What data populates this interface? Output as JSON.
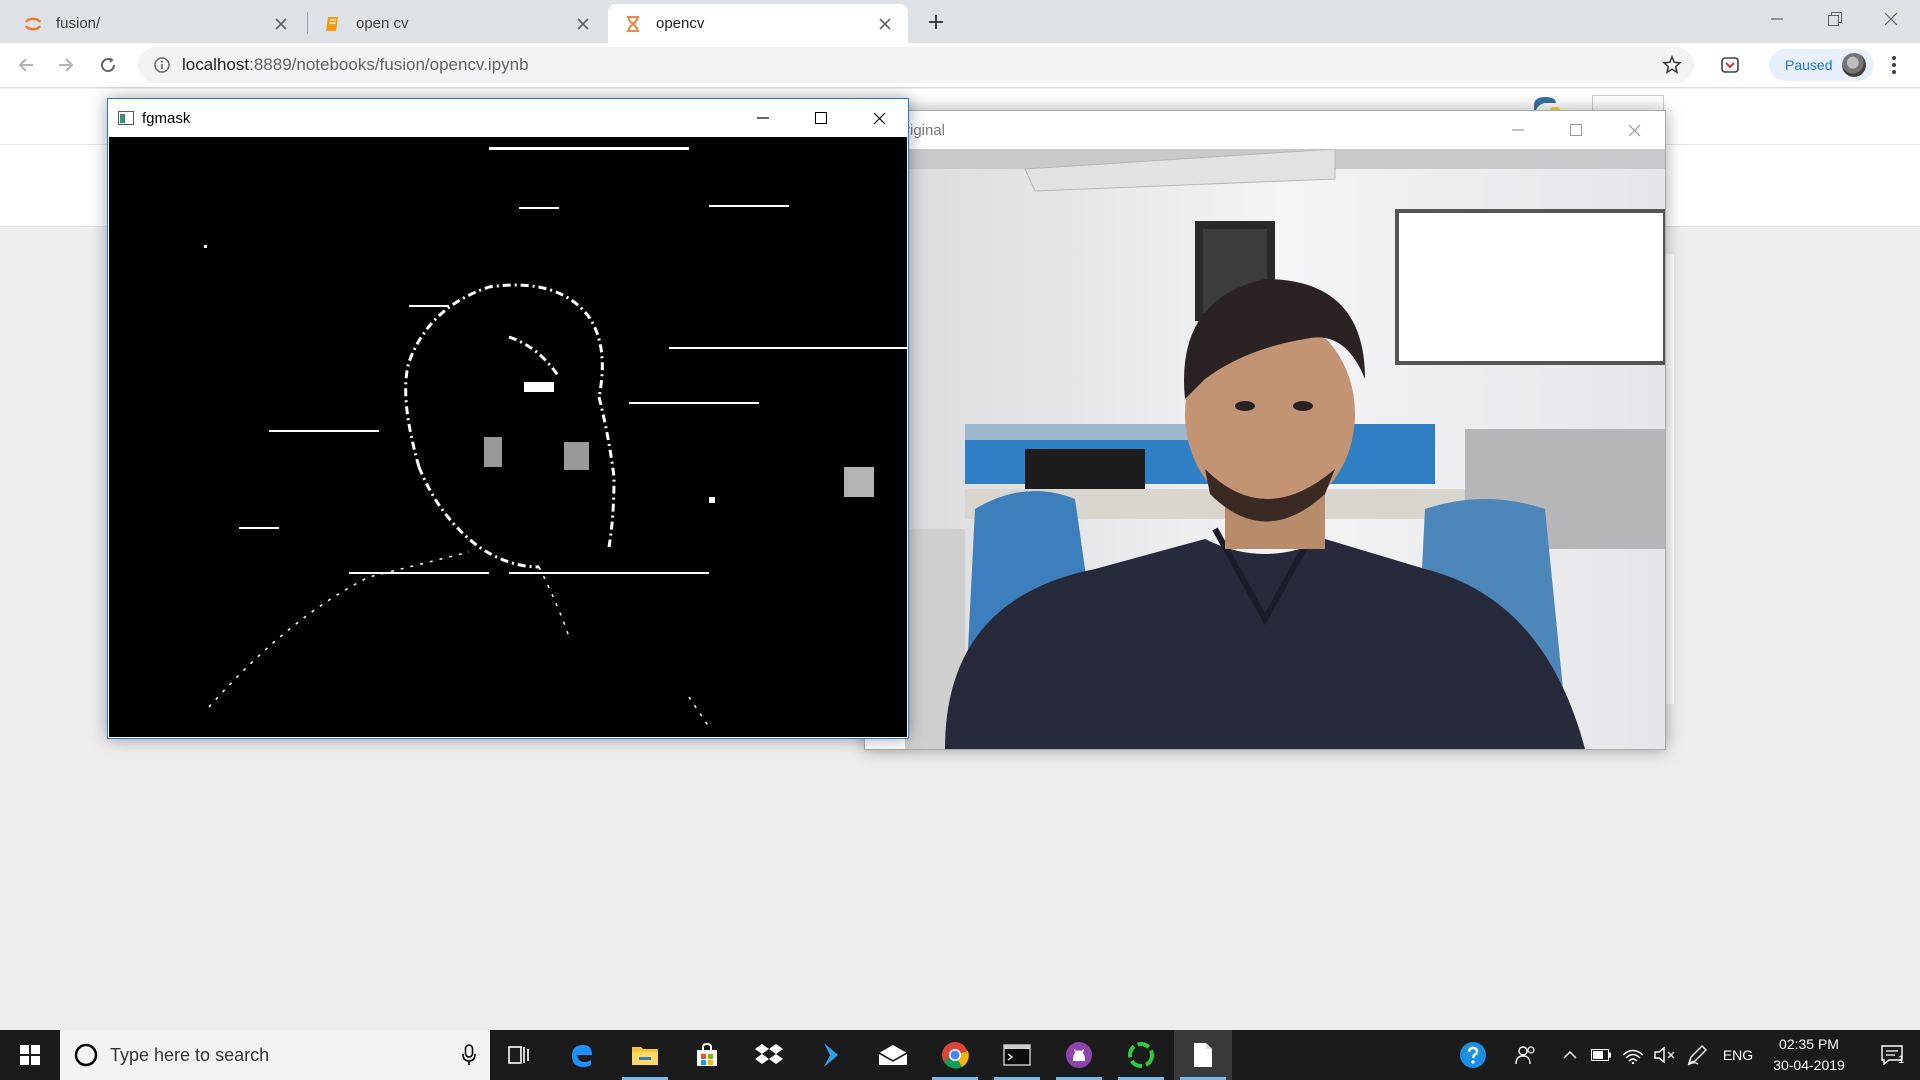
{
  "browser": {
    "tabs": [
      {
        "title": "fusion/",
        "icon": "jupyter-icon"
      },
      {
        "title": "open cv",
        "icon": "notebook-icon"
      },
      {
        "title": "opencv",
        "icon": "hourglass-icon",
        "active": true
      }
    ],
    "url_host": "localhost",
    "url_rest": ":8889/notebooks/fusion/opencv.ipynb",
    "profile_status": "Paused"
  },
  "windows": {
    "fgmask": {
      "title": "fgmask"
    },
    "original": {
      "title": "riginal"
    }
  },
  "taskbar": {
    "search_placeholder": "Type here to search",
    "apps": [
      "task-view",
      "edge",
      "file-explorer",
      "store",
      "dropbox",
      "visual-studio",
      "mail",
      "chrome",
      "terminal",
      "github",
      "spinner-app",
      "notepad"
    ],
    "language": "ENG",
    "time": "02:35 PM",
    "date": "30-04-2019",
    "notification_count": "1"
  },
  "colors": {
    "accent": "#1a73e8",
    "tab_strip": "#dee1e6",
    "taskbar": "#1b1b1b",
    "window_border": "#2b79c2"
  }
}
